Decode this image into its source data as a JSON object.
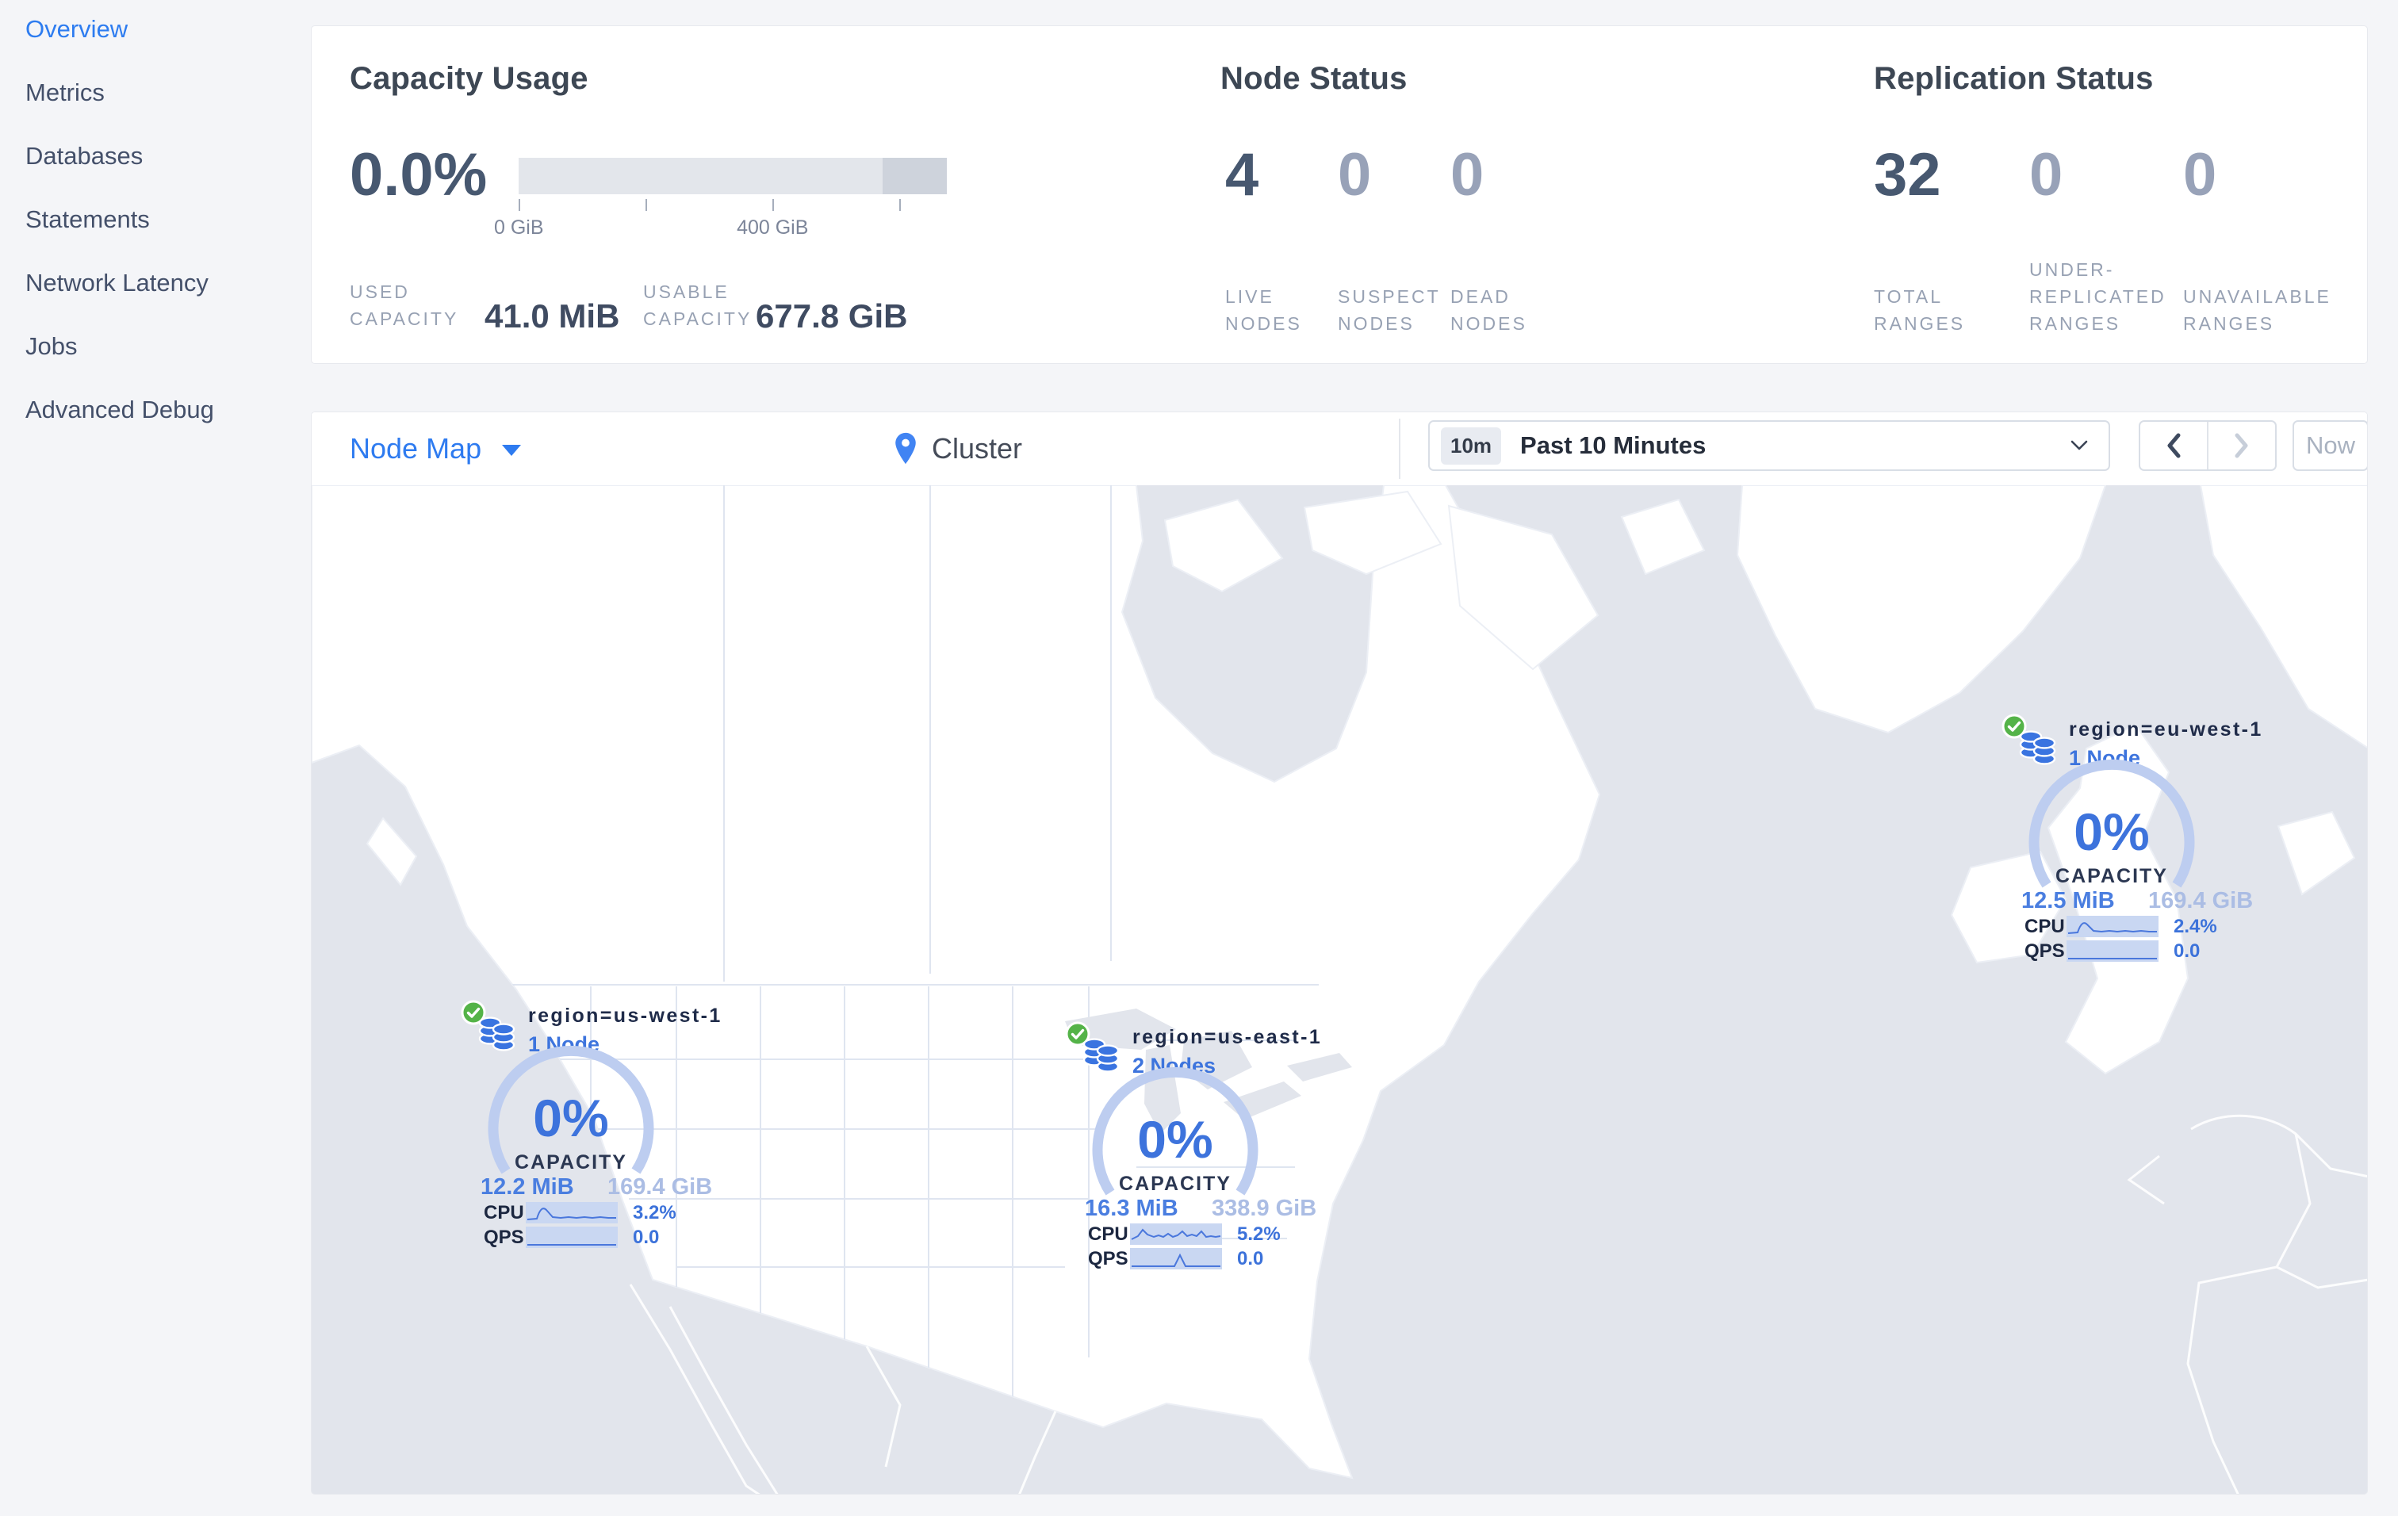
{
  "colors": {
    "accent_blue": "#2d7cf0",
    "marker_blue": "#3d74dd",
    "success_green": "#54b348",
    "ocean": "#e2e5ec",
    "land": "#ffffff",
    "bar_fill": "#e3e6eb",
    "bar_overflow": "#ced3dc"
  },
  "sidebar": {
    "items": [
      {
        "label": "Overview",
        "active": true
      },
      {
        "label": "Metrics",
        "active": false
      },
      {
        "label": "Databases",
        "active": false
      },
      {
        "label": "Statements",
        "active": false
      },
      {
        "label": "Network Latency",
        "active": false
      },
      {
        "label": "Jobs",
        "active": false
      },
      {
        "label": "Advanced Debug",
        "active": false
      }
    ]
  },
  "summary": {
    "capacity": {
      "title": "Capacity Usage",
      "percent": "0.0%",
      "tick_labels": [
        "0 GiB",
        "400 GiB"
      ],
      "used": {
        "label_lines": [
          "USED",
          "CAPACITY"
        ],
        "value": "41.0 MiB"
      },
      "usable": {
        "label_lines": [
          "USABLE",
          "CAPACITY"
        ],
        "value": "677.8 GiB"
      }
    },
    "nodes": {
      "title": "Node Status",
      "metrics": [
        {
          "value": "4",
          "label_lines": [
            "LIVE",
            "NODES"
          ]
        },
        {
          "value": "0",
          "label_lines": [
            "SUSPECT",
            "NODES"
          ]
        },
        {
          "value": "0",
          "label_lines": [
            "DEAD",
            "NODES"
          ]
        }
      ]
    },
    "replication": {
      "title": "Replication Status",
      "metrics": [
        {
          "value": "32",
          "label_lines": [
            "TOTAL",
            "RANGES"
          ]
        },
        {
          "value": "0",
          "label_lines": [
            "UNDER-",
            "REPLICATED",
            "RANGES"
          ]
        },
        {
          "value": "0",
          "label_lines": [
            "UNAVAILABLE",
            "RANGES"
          ]
        }
      ]
    }
  },
  "toolbar": {
    "view_selector": "Node Map",
    "breadcrumb": "Cluster",
    "time_badge": "10m",
    "time_range": "Past 10 Minutes",
    "now_label": "Now"
  },
  "map": {
    "markers": [
      {
        "region": "region=us-west-1",
        "nodes": "1 Node",
        "percent": "0%",
        "capacity_label": "CAPACITY",
        "used": "12.2 MiB",
        "total": "169.4 GiB",
        "cpu_label": "CPU",
        "cpu": "3.2%",
        "qps_label": "QPS",
        "qps": "0.0"
      },
      {
        "region": "region=us-east-1",
        "nodes": "2 Nodes",
        "percent": "0%",
        "capacity_label": "CAPACITY",
        "used": "16.3 MiB",
        "total": "338.9 GiB",
        "cpu_label": "CPU",
        "cpu": "5.2%",
        "qps_label": "QPS",
        "qps": "0.0"
      },
      {
        "region": "region=eu-west-1",
        "nodes": "1 Node",
        "percent": "0%",
        "capacity_label": "CAPACITY",
        "used": "12.5 MiB",
        "total": "169.4 GiB",
        "cpu_label": "CPU",
        "cpu": "2.4%",
        "qps_label": "QPS",
        "qps": "0.0"
      }
    ]
  },
  "icons": {
    "view_caret": "caret-down",
    "breadcrumb_pin": "map-pin",
    "time_chevron": "chevron-down",
    "prev": "chevron-left",
    "next": "chevron-right",
    "region_health": "check-circle",
    "region_glyph": "database-stack"
  }
}
